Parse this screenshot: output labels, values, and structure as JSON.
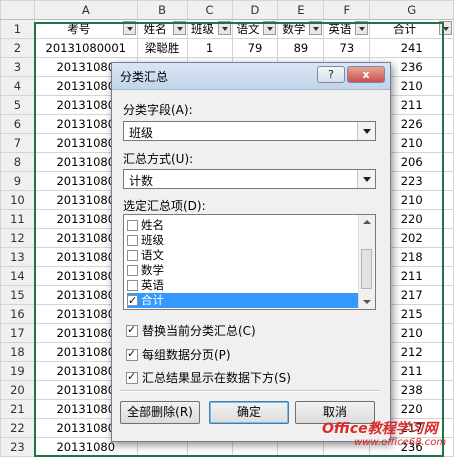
{
  "columns": [
    "A",
    "B",
    "C",
    "D",
    "E",
    "F",
    "G"
  ],
  "headers": [
    "考号",
    "姓名",
    "班级",
    "语文",
    "数学",
    "英语",
    "合计"
  ],
  "header_display": [
    "考号",
    "姓名",
    "班级",
    "语文",
    "数学",
    "英语",
    "合计"
  ],
  "rows": [
    [
      "20131080001",
      "梁聪胜",
      "1",
      "79",
      "89",
      "73",
      "241"
    ],
    [
      "20131080",
      "",
      "",
      "",
      "",
      "",
      "236"
    ],
    [
      "20131080",
      "",
      "",
      "",
      "",
      "",
      "210"
    ],
    [
      "20131080",
      "",
      "",
      "",
      "",
      "",
      "211"
    ],
    [
      "20131080",
      "",
      "",
      "",
      "",
      "",
      "226"
    ],
    [
      "20131080",
      "",
      "",
      "",
      "",
      "",
      "210"
    ],
    [
      "20131080",
      "",
      "",
      "",
      "",
      "",
      "206"
    ],
    [
      "20131080",
      "",
      "",
      "",
      "",
      "",
      "223"
    ],
    [
      "20131080",
      "",
      "",
      "",
      "",
      "",
      "210"
    ],
    [
      "20131080",
      "",
      "",
      "",
      "",
      "",
      "220"
    ],
    [
      "20131080",
      "",
      "",
      "",
      "",
      "",
      "202"
    ],
    [
      "20131080",
      "",
      "",
      "",
      "",
      "",
      "218"
    ],
    [
      "20131080",
      "",
      "",
      "",
      "",
      "",
      "211"
    ],
    [
      "20131080",
      "",
      "",
      "",
      "",
      "",
      "217"
    ],
    [
      "20131080",
      "",
      "",
      "",
      "",
      "",
      "215"
    ],
    [
      "20131080",
      "",
      "",
      "",
      "",
      "",
      "210"
    ],
    [
      "20131080",
      "",
      "",
      "",
      "",
      "",
      "212"
    ],
    [
      "20131080",
      "",
      "",
      "",
      "",
      "",
      "211"
    ],
    [
      "20131080",
      "",
      "",
      "",
      "",
      "",
      "238"
    ],
    [
      "20131080",
      "",
      "",
      "",
      "",
      "",
      "220"
    ],
    [
      "20131080",
      "",
      "",
      "",
      "",
      "",
      "217"
    ],
    [
      "20131080",
      "",
      "",
      "",
      "",
      "",
      "236"
    ],
    [
      "20131080023",
      "邱茜谋",
      "1",
      "82",
      "69",
      "79",
      "230"
    ]
  ],
  "row_numbers": [
    "1",
    "2",
    "3",
    "4",
    "5",
    "6",
    "7",
    "8",
    "9",
    "10",
    "11",
    "12",
    "13",
    "14",
    "15",
    "16",
    "17",
    "18",
    "19",
    "20",
    "21",
    "22",
    "23",
    "24"
  ],
  "dialog": {
    "title": "分类汇总",
    "help": "?",
    "close": "x",
    "group_field_label": "分类字段(A):",
    "group_field_value": "班级",
    "function_label": "汇总方式(U):",
    "function_value": "计数",
    "items_label": "选定汇总项(D):",
    "items": [
      {
        "label": "姓名",
        "checked": false,
        "selected": false
      },
      {
        "label": "班级",
        "checked": false,
        "selected": false
      },
      {
        "label": "语文",
        "checked": false,
        "selected": false
      },
      {
        "label": "数学",
        "checked": false,
        "selected": false
      },
      {
        "label": "英语",
        "checked": false,
        "selected": false
      },
      {
        "label": "合计",
        "checked": true,
        "selected": true
      }
    ],
    "options": [
      {
        "label": "替换当前分类汇总(C)",
        "checked": true
      },
      {
        "label": "每组数据分页(P)",
        "checked": true
      },
      {
        "label": "汇总结果显示在数据下方(S)",
        "checked": true
      }
    ],
    "remove_all": "全部删除(R)",
    "ok": "确定",
    "cancel": "取消"
  },
  "watermark": {
    "line1": "Office教程学习网",
    "line2": "www.office68.com",
    "color": "#d82b2b"
  }
}
